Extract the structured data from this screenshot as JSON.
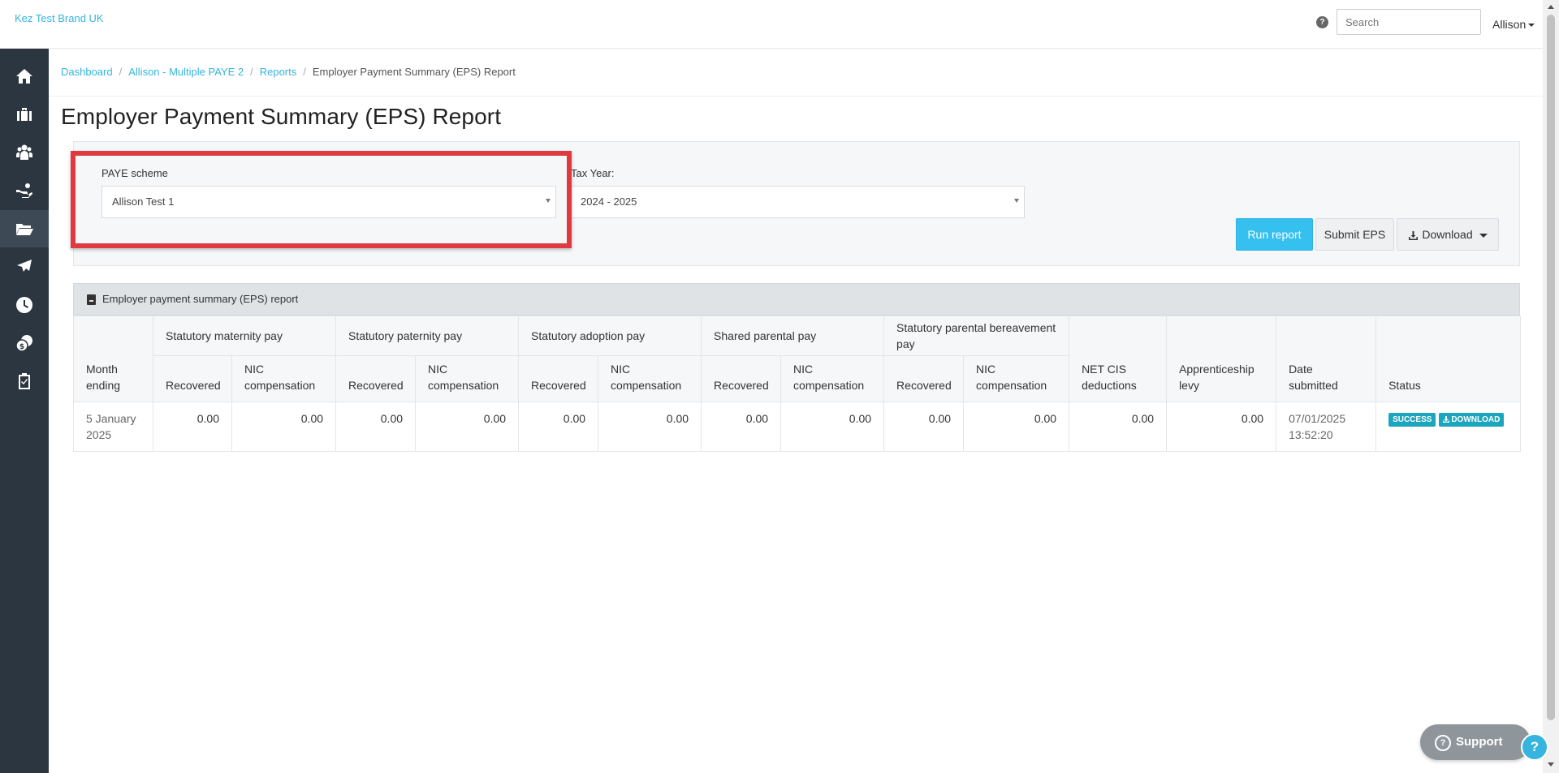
{
  "header": {
    "brand": "Kez Test Brand UK",
    "help_icon": "?",
    "search_placeholder": "Search",
    "user": "Allison"
  },
  "sidebar": {
    "items": [
      {
        "icon": "home-icon"
      },
      {
        "icon": "briefcase-icon"
      },
      {
        "icon": "people-icon"
      },
      {
        "icon": "hand-payment-icon"
      },
      {
        "icon": "folder-icon",
        "active": true
      },
      {
        "icon": "plane-icon"
      },
      {
        "icon": "clock-icon"
      },
      {
        "icon": "coins-icon"
      },
      {
        "icon": "clipboard-check-icon"
      }
    ]
  },
  "breadcrumb": {
    "items": [
      "Dashboard",
      "Allison - Multiple PAYE 2",
      "Reports"
    ],
    "current": "Employer Payment Summary (EPS) Report",
    "separator": "/"
  },
  "page": {
    "title": "Employer Payment Summary (EPS) Report"
  },
  "filters": {
    "paye_label": "PAYE scheme",
    "paye_value": "Allison Test 1",
    "tax_year_label": "Tax Year:",
    "tax_year_value": "2024 - 2025"
  },
  "actions": {
    "run_report": "Run report",
    "submit_eps": "Submit EPS",
    "download": "Download"
  },
  "report": {
    "title": "Employer payment summary (EPS) report",
    "groups": {
      "maternity": "Statutory maternity pay",
      "paternity": "Statutory paternity pay",
      "adoption": "Statutory adoption pay",
      "shared": "Shared parental pay",
      "bereavement": "Statutory parental bereavement pay"
    },
    "columns": {
      "month_ending": "Month ending",
      "recovered": "Recovered",
      "nic_compensation": "NIC compensation",
      "net_cis": "NET CIS deductions",
      "apprenticeship": "Apprenticeship levy",
      "date_submitted": "Date submitted",
      "status": "Status"
    },
    "rows": [
      {
        "month_ending": "5 January 2025",
        "mat_recovered": "0.00",
        "mat_nic": "0.00",
        "pat_recovered": "0.00",
        "pat_nic": "0.00",
        "adop_recovered": "0.00",
        "adop_nic": "0.00",
        "shared_recovered": "0.00",
        "shared_nic": "0.00",
        "ber_recovered": "0.00",
        "ber_nic": "0.00",
        "net_cis": "0.00",
        "apprenticeship": "0.00",
        "date_submitted": "07/01/2025 13:52:20",
        "status_badge": "SUCCESS",
        "download_badge": "DOWNLOAD"
      }
    ]
  },
  "support": {
    "label": "Support",
    "fab": "?"
  },
  "colors": {
    "accent": "#35b5de",
    "sidebar": "#2b3640",
    "primary_button": "#35c0ef",
    "badge": "#1ca6be",
    "highlight": "#e03a40"
  }
}
